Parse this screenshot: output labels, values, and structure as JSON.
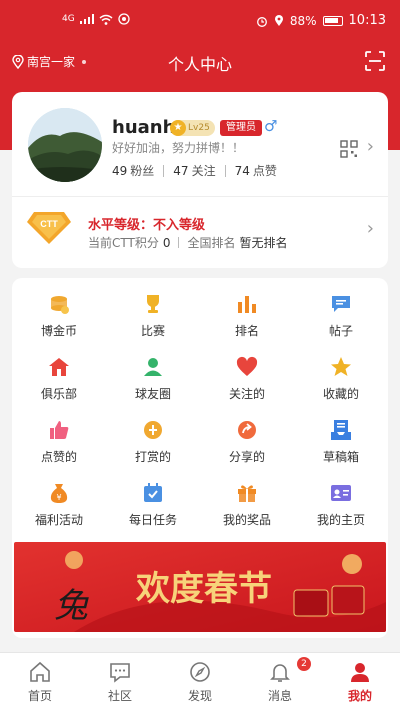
{
  "status_bar": {
    "network": "4G",
    "battery": "88%",
    "time": "10:13"
  },
  "header": {
    "location": "南宫一家",
    "title": "个人中心"
  },
  "profile": {
    "username": "huanh",
    "level_badge": "Lv25",
    "role_badge": "管理员",
    "gender_symbol": "♂",
    "motto": "好好加油，努力拼博！！",
    "stats": [
      {
        "count": "49",
        "label": "粉丝"
      },
      {
        "count": "47",
        "label": "关注"
      },
      {
        "count": "74",
        "label": "点赞"
      }
    ]
  },
  "ranking": {
    "badge_text": "CTT",
    "level_label": "水平等级：",
    "level_value": "不入等级",
    "points_label": "当前CTT积分",
    "points_value": "0",
    "rank_label": "全国排名",
    "rank_value": "暂无排名"
  },
  "menu": [
    {
      "label": "博金币",
      "icon": "coins-icon",
      "color": "#f0a830"
    },
    {
      "label": "比赛",
      "icon": "trophy-icon",
      "color": "#f0b226"
    },
    {
      "label": "排名",
      "icon": "bar-chart-icon",
      "color": "#f08a24"
    },
    {
      "label": "帖子",
      "icon": "message-icon",
      "color": "#4a90e2"
    },
    {
      "label": "俱乐部",
      "icon": "home-icon",
      "color": "#e8453c"
    },
    {
      "label": "球友圈",
      "icon": "user-icon",
      "color": "#34b36a"
    },
    {
      "label": "关注的",
      "icon": "heart-icon",
      "color": "#e8453c"
    },
    {
      "label": "收藏的",
      "icon": "star-icon",
      "color": "#f0b226"
    },
    {
      "label": "点赞的",
      "icon": "thumbs-up-icon",
      "color": "#f06080"
    },
    {
      "label": "打赏的",
      "icon": "reward-icon",
      "color": "#f0a830"
    },
    {
      "label": "分享的",
      "icon": "share-icon",
      "color": "#f06a3c"
    },
    {
      "label": "草稿箱",
      "icon": "draft-icon",
      "color": "#3a7fe0"
    },
    {
      "label": "福利活动",
      "icon": "money-bag-icon",
      "color": "#f08a24"
    },
    {
      "label": "每日任务",
      "icon": "calendar-check-icon",
      "color": "#4a90e2"
    },
    {
      "label": "我的奖品",
      "icon": "gift-icon",
      "color": "#f08a24"
    },
    {
      "label": "我的主页",
      "icon": "profile-card-icon",
      "color": "#7a6ee0"
    }
  ],
  "banner": {
    "text": "欢度春节",
    "logo_text": "兔"
  },
  "bottom_nav": [
    {
      "label": "首页",
      "icon": "home-outline-icon",
      "active": false
    },
    {
      "label": "社区",
      "icon": "chat-icon",
      "active": false
    },
    {
      "label": "发现",
      "icon": "compass-icon",
      "active": false
    },
    {
      "label": "消息",
      "icon": "bell-icon",
      "active": false,
      "badge": "2"
    },
    {
      "label": "我的",
      "icon": "person-icon",
      "active": true
    }
  ],
  "colors": {
    "brand": "#d8262c",
    "background": "#f3f3f3"
  }
}
